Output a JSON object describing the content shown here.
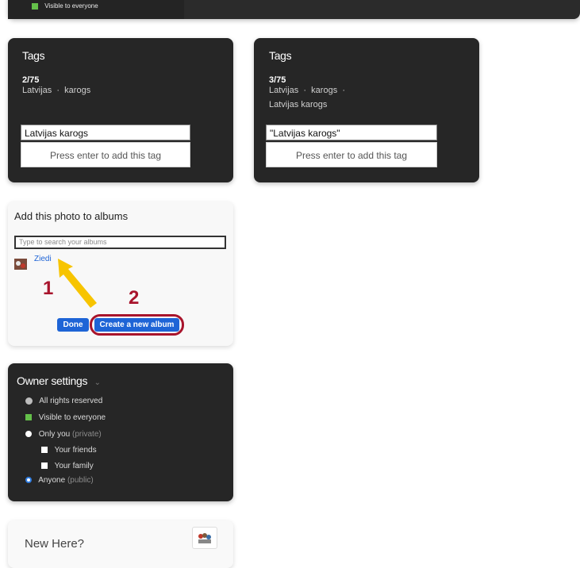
{
  "top_strip": {
    "visibility_label": "Visible to everyone"
  },
  "tags_left": {
    "title": "Tags",
    "count": "2/75",
    "tags_line": "Latvijas  ·  karogs",
    "input_value": "Latvijas karogs",
    "hint": "Press enter to add this tag"
  },
  "tags_right": {
    "title": "Tags",
    "count": "3/75",
    "tags_line": "Latvijas  ·  karogs  ·",
    "tags_line2": "Latvijas karogs",
    "input_value": "\"Latvijas karogs\"",
    "hint": "Press enter to add this tag"
  },
  "albums": {
    "title": "Add this photo to albums",
    "search_placeholder": "Type to search your albums",
    "album_name": "Ziedi",
    "annotation_1": "1",
    "annotation_2": "2",
    "done_label": "Done",
    "create_label": "Create a new album",
    "arrow_color": "#f7c400",
    "annotation_color": "#a8142c"
  },
  "owner": {
    "title": "Owner settings",
    "rights": "All rights reserved",
    "visible": "Visible to everyone",
    "only_you": "Only you",
    "private": "(private)",
    "friends": "Your friends",
    "family": "Your family",
    "anyone": "Anyone",
    "public": "(public)"
  },
  "new_here": {
    "title": "New Here?"
  }
}
